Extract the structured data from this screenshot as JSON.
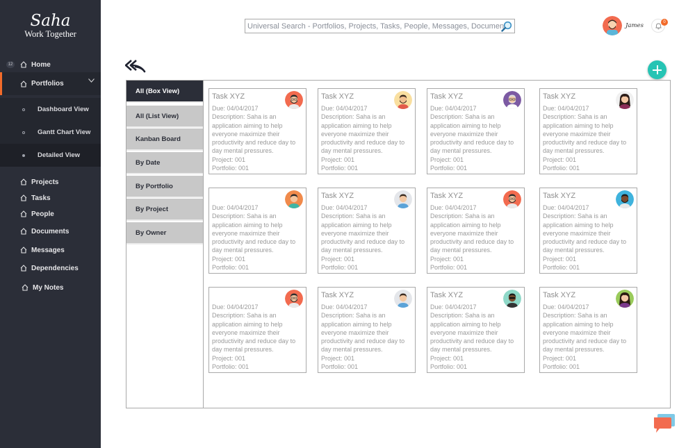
{
  "app": {
    "logo_line1": "Saha",
    "logo_line2": "Work Together"
  },
  "sidebar": {
    "badge": "12",
    "home": "Home",
    "portfolios": "Portfolios",
    "sub": [
      "Dashboard View",
      "Gantt Chart View",
      "Detailed View"
    ],
    "items": [
      "Projects",
      "Tasks",
      "People",
      "Documents",
      "Messages",
      "Dependencies",
      "My Notes"
    ]
  },
  "header": {
    "search_placeholder": "Universal Search - Portfolios, Projects, Tasks, People, Messages, Documents",
    "username": "James",
    "notif_count": "0"
  },
  "views": [
    "All (Box View)",
    "All (List View)",
    "Kanban Board",
    "By Date",
    "By Portfolio",
    "By Project",
    "By Owner"
  ],
  "cards": [
    {
      "title": "Task XYZ",
      "due": "Due: 04/04/2017",
      "desc": "Description:  Saha is an application aiming to help everyone maximize their productivity and reduce day to day mental pressures.",
      "project": "Project: 001",
      "portfolio": "Portfolio: 001",
      "avatar": "bearded-orange"
    },
    {
      "title": "Task XYZ",
      "due": "Due: 04/04/2017",
      "desc": "Description:  Saha is an application aiming to help everyone maximize their productivity and reduce day to day mental pressures.",
      "project": "Project: 001",
      "portfolio": "Portfolio: 001",
      "avatar": "bearded-yellow"
    },
    {
      "title": "Task XYZ",
      "due": "Due: 04/04/2017",
      "desc": "Description:  Saha is an application aiming to help everyone maximize their productivity and reduce day to day mental pressures.",
      "project": "Project: 001",
      "portfolio": "Portfolio: 001",
      "avatar": "old-purple"
    },
    {
      "title": "Task XYZ",
      "due": "Due: 04/04/2017",
      "desc": "Description:  Saha is an application aiming to help everyone maximize their productivity and reduce day to day mental pressures.",
      "project": "Project: 001",
      "portfolio": "Portfolio: 001",
      "avatar": "woman-white"
    },
    {
      "title": "",
      "due": "Due: 04/04/2017",
      "desc": "Description:  Saha is an application aiming to help everyone maximize their productivity and reduce day to day mental pressures.",
      "project": "Project: 001",
      "portfolio": "Portfolio: 001",
      "avatar": "man-orange"
    },
    {
      "title": "Task XYZ",
      "due": "Due: 04/04/2017",
      "desc": "Description:  Saha is an application aiming to help everyone maximize their productivity and reduce day to day mental pressures.",
      "project": "Project: 001",
      "portfolio": "Portfolio: 001",
      "avatar": "man-grey"
    },
    {
      "title": "Task XYZ",
      "due": "Due: 04/04/2017",
      "desc": "Description:  Saha is an application aiming to help everyone maximize their productivity and reduce day to day mental pressures.",
      "project": "Project: 001",
      "portfolio": "Portfolio: 001",
      "avatar": "bearded-orange"
    },
    {
      "title": "Task XYZ",
      "due": "Due: 04/04/2017",
      "desc": "Description:  Saha is an application aiming to help everyone maximize their productivity and reduce day to day mental pressures.",
      "project": "Project: 001",
      "portfolio": "Portfolio: 001",
      "avatar": "man-blue"
    },
    {
      "title": "",
      "due": "Due: 04/04/2017",
      "desc": "Description:  Saha is an application aiming to help everyone maximize their productivity and reduce day to day mental pressures.",
      "project": "Project: 001",
      "portfolio": "Portfolio: 001",
      "avatar": "bearded-orange"
    },
    {
      "title": "Task XYZ",
      "due": "Due: 04/04/2017",
      "desc": "Description:  Saha is an application aiming to help everyone maximize their productivity and reduce day to day mental pressures.",
      "project": "Project: 001",
      "portfolio": "Portfolio: 001",
      "avatar": "man-grey"
    },
    {
      "title": "Task XYZ",
      "due": "Due: 04/04/2017",
      "desc": "Description:  Saha is an application aiming to help everyone maximize their productivity and reduce day to day mental pressures.",
      "project": "Project: 001",
      "portfolio": "Portfolio: 001",
      "avatar": "glasses-teal"
    },
    {
      "title": "Task XYZ",
      "due": "Due: 04/04/2017",
      "desc": "Description:  Saha is an application aiming to help everyone maximize their productivity and reduce day to day mental pressures.",
      "project": "Project: 001",
      "portfolio": "Portfolio: 001",
      "avatar": "woman-green"
    }
  ],
  "colors": {
    "sidebar": "#2b2e38",
    "accent": "#f26b2a",
    "add": "#26c4b4",
    "chat": "#f26b2a"
  },
  "icons": {
    "back": "double-reply-icon",
    "add": "plus-icon",
    "search": "magnifier-icon",
    "bell": "bell-icon",
    "chat": "chat-bubble-icon"
  }
}
